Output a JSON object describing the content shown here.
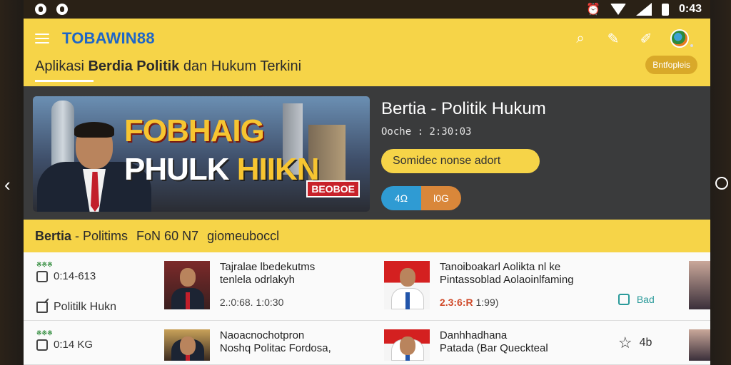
{
  "status_bar": {
    "time": "0:43",
    "icons": [
      "app-icon-1",
      "app-icon-2",
      "alarm-icon",
      "wifi-icon",
      "signal-icon",
      "battery-icon"
    ]
  },
  "app_bar": {
    "brand": "TOBAWIN88",
    "subtitle_pre": "Aplikasi ",
    "subtitle_bold": "Berdia Politik",
    "subtitle_post": " dan Hukum Terkini",
    "sub_button": "Bntfopleis",
    "actions": [
      "search-icon",
      "edit-icon",
      "compose-icon",
      "globe-icon"
    ]
  },
  "hero": {
    "image_title_1": "FOBHAIG",
    "image_title_2_white": "PHULK ",
    "image_title_2_yellow": "HIIKN",
    "image_tag": "BEOBOE",
    "heading": "Bertia - Politik Hukum",
    "date": "Ooche : 2:30:03",
    "pill_text": "Somidec nonse adort",
    "btn_left": "4Ω",
    "btn_right": "l0G"
  },
  "section": {
    "title_bold": "Bertia",
    "title_rest": " - Politims",
    "code": "FoN 60 N7",
    "extra": "giomeuboccl"
  },
  "rows": [
    {
      "badge": "※※※",
      "time": "0:14-613",
      "meta_label": "Politilk Hukn",
      "item1_text_1": "Tajralae lbedekutms",
      "item1_text_2": "tenlela odrlakyh",
      "item1_stat": "2.:0:68. 1:0:30",
      "item2_text_1": "Tanoiboakarl Aolikta nl ke",
      "item2_text_2": "Pintassoblad Aolaoinlfaming",
      "item2_stat_red": "2.3:6:R",
      "item2_stat_grey": " 1:99)",
      "right_value": "Bad"
    },
    {
      "badge": "※※※",
      "time": "0:14 KG",
      "item1_text_1": "Naoacnochotpron",
      "item1_text_2": "Noshq Politac Fordosa,",
      "item2_text_1": "Danhhadhana",
      "item2_text_2": "Patada (Bar Queckteal",
      "right_value": "4b"
    }
  ]
}
